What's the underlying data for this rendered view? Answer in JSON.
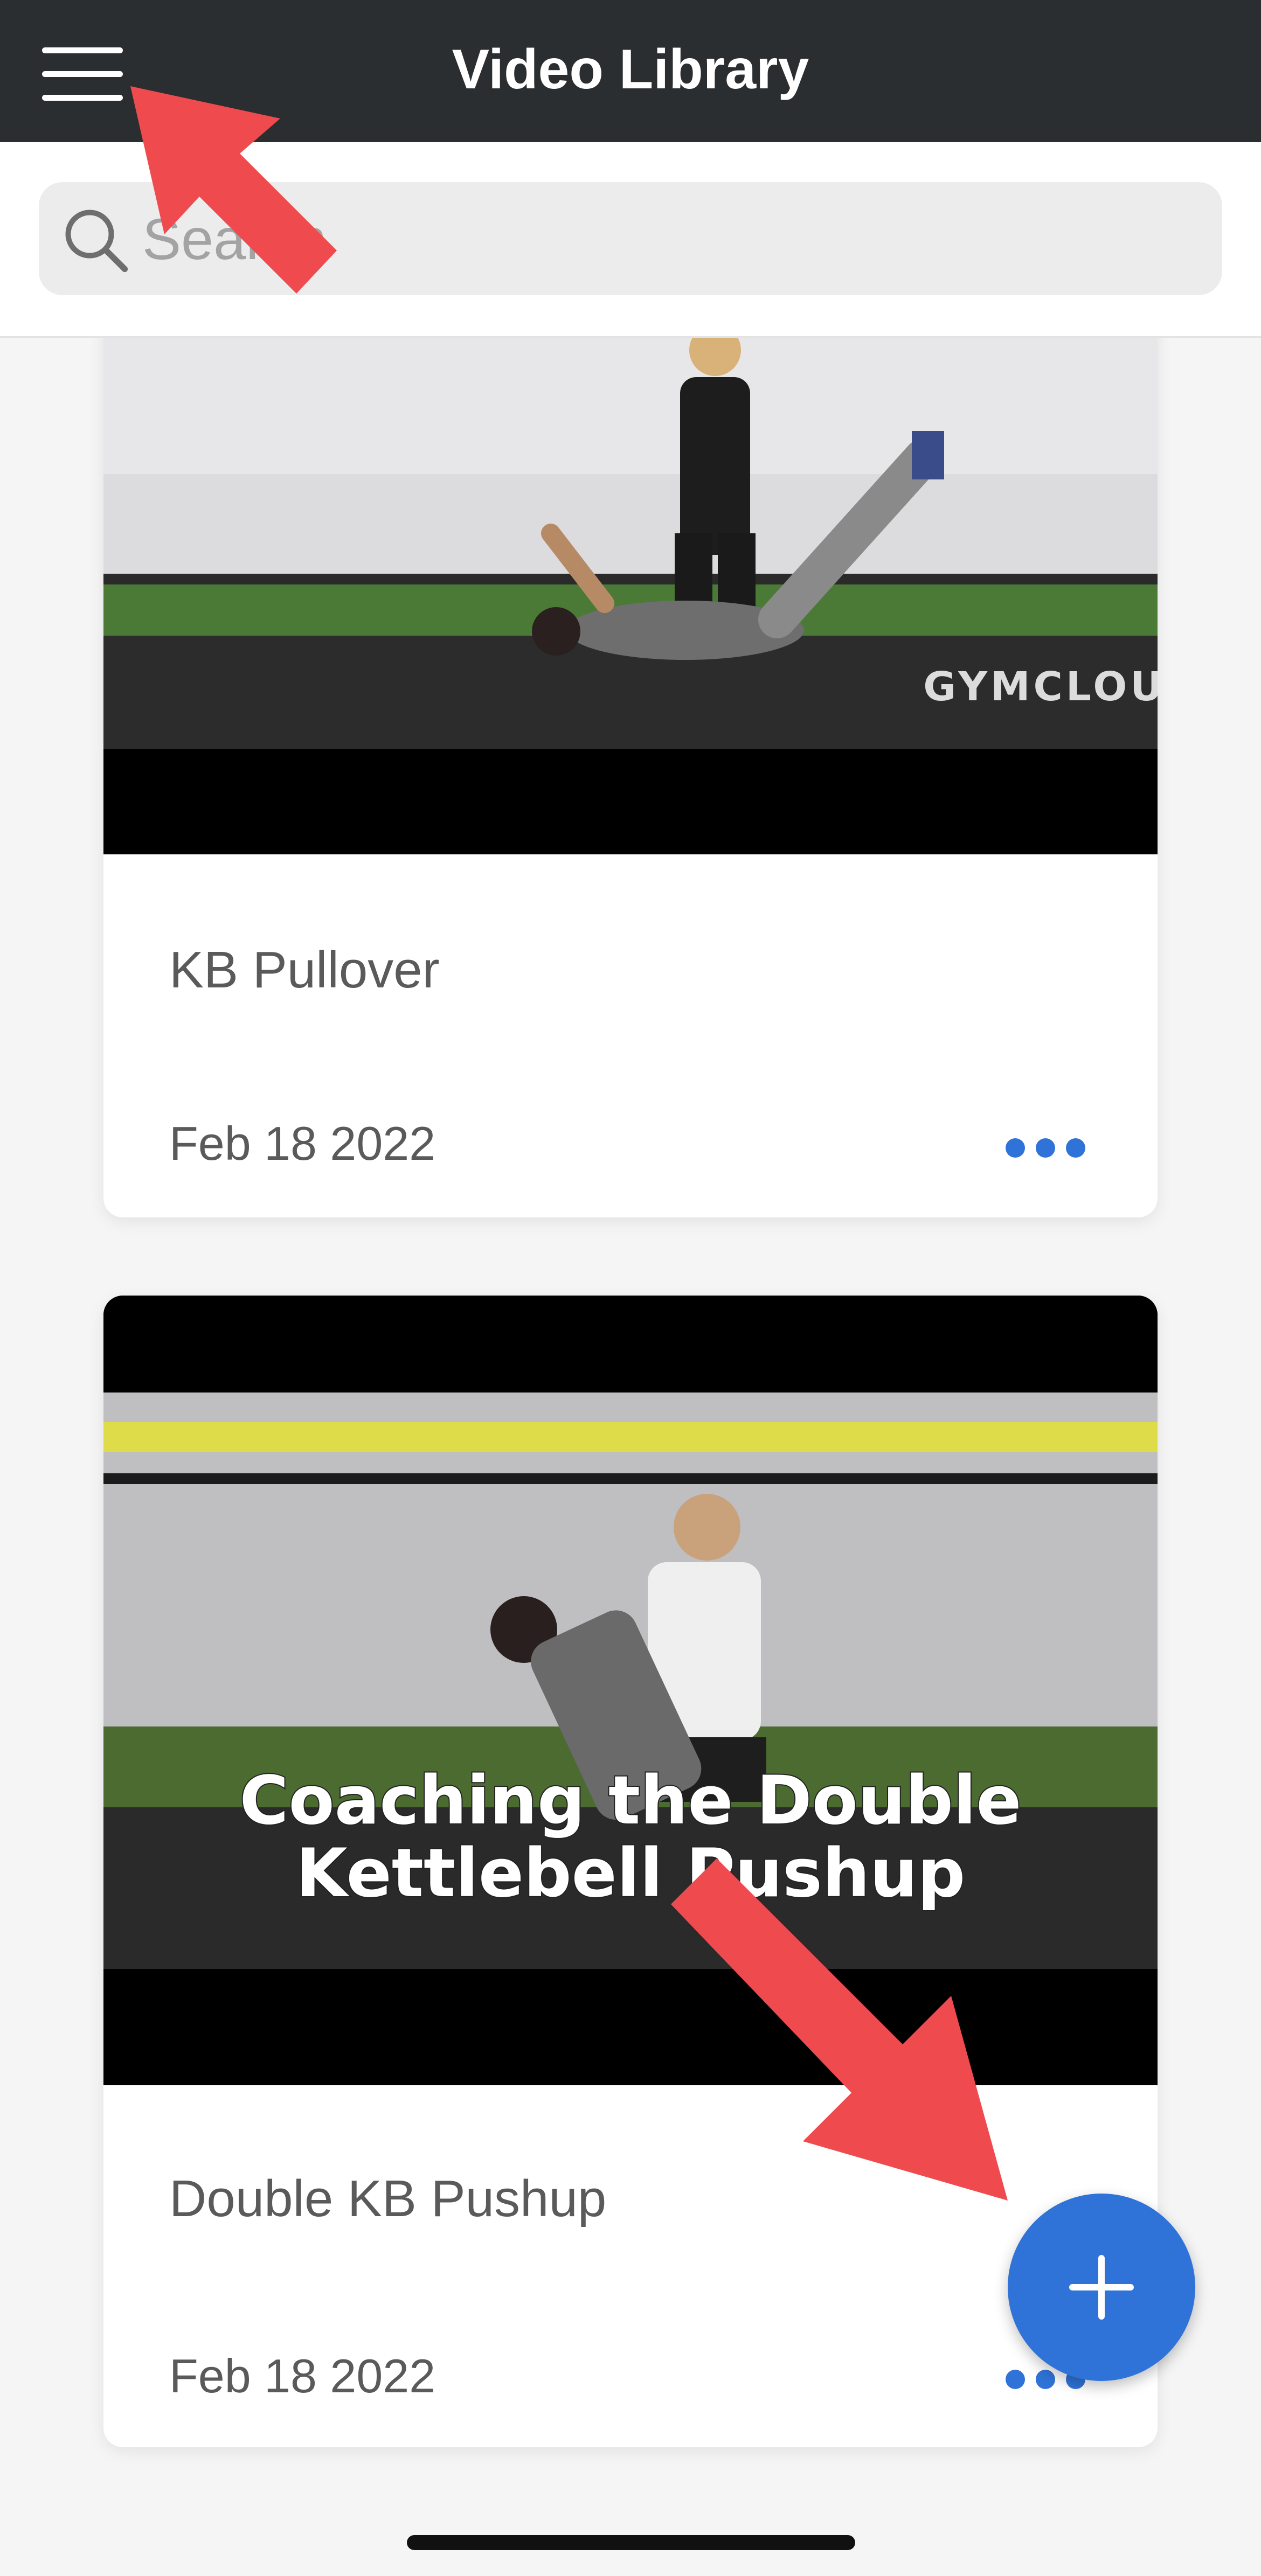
{
  "header": {
    "title": "Video Library",
    "menu_icon": "hamburger-menu-icon"
  },
  "search": {
    "placeholder": "Search",
    "value": "",
    "icon": "search-icon"
  },
  "videos": [
    {
      "title": "KB Pullover",
      "date": "Feb 18 2022",
      "thumbnail_watermark": "GYMCLOUD",
      "more_icon": "more-horizontal-icon"
    },
    {
      "title": "Double KB Pushup",
      "date": "Feb 18 2022",
      "thumbnail_caption_line1": "Coaching the Double",
      "thumbnail_caption_line2": "Kettlebell Pushup",
      "more_icon": "more-horizontal-icon"
    }
  ],
  "fab": {
    "icon": "plus-icon"
  },
  "colors": {
    "header_bg": "#2b2e30",
    "accent": "#2f73d8",
    "annotation_arrow": "#ef4b4f"
  }
}
